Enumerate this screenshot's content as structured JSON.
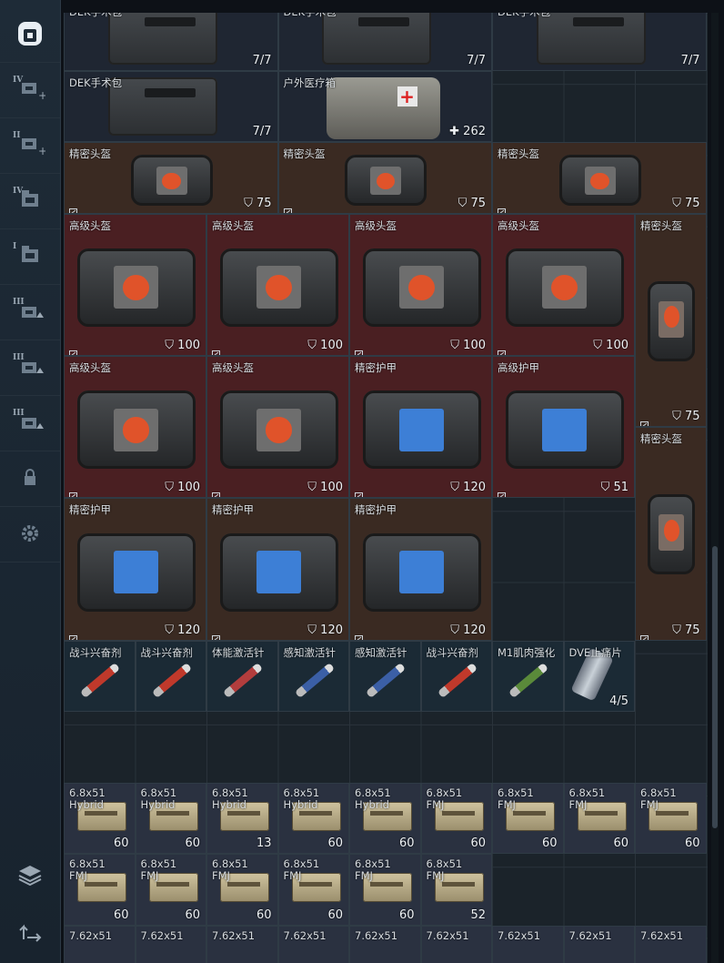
{
  "sidebar": {
    "buttons": [
      {
        "name": "backpack-icon",
        "tier": "",
        "active": true
      },
      {
        "name": "add-cell-icon",
        "tier": "IV"
      },
      {
        "name": "add-cell-icon",
        "tier": "II"
      },
      {
        "name": "folder-icon",
        "tier": "IV"
      },
      {
        "name": "folder-icon",
        "tier": "I"
      },
      {
        "name": "upgrade-icon",
        "tier": "III"
      },
      {
        "name": "upgrade-icon",
        "tier": "III"
      },
      {
        "name": "upgrade-icon",
        "tier": "III"
      },
      {
        "name": "lock-icon",
        "tier": ""
      },
      {
        "name": "gear-icon",
        "tier": ""
      }
    ],
    "bottom_buttons": [
      {
        "name": "layers-icon"
      },
      {
        "name": "transfer-icon"
      }
    ]
  },
  "items": [
    {
      "name": "DEK手术包",
      "count": "7/7",
      "kind": "kit",
      "type": "med"
    },
    {
      "name": "DEK手术包",
      "count": "7/7",
      "kind": "kit",
      "type": "med"
    },
    {
      "name": "DEK手术包",
      "count": "7/7",
      "kind": "kit",
      "type": "med"
    },
    {
      "name": "DEK手术包",
      "count": "7/7",
      "kind": "kit",
      "type": "med"
    },
    {
      "name": "户外医疗箱",
      "count": "✚ 262",
      "kind": "medkit",
      "type": "med"
    },
    {
      "name": "精密头盔",
      "count": "⛉ 75",
      "kind": "bag-s",
      "type": "helm"
    },
    {
      "name": "精密头盔",
      "count": "⛉ 75",
      "kind": "bag-s",
      "type": "helm"
    },
    {
      "name": "精密头盔",
      "count": "⛉ 75",
      "kind": "bag-s",
      "type": "helm"
    },
    {
      "name": "高级头盔",
      "count": "⛉ 100",
      "kind": "bag-l",
      "type": "helm2"
    },
    {
      "name": "高级头盔",
      "count": "⛉ 100",
      "kind": "bag-l",
      "type": "helm2"
    },
    {
      "name": "高级头盔",
      "count": "⛉ 100",
      "kind": "bag-l",
      "type": "helm2"
    },
    {
      "name": "高级头盔",
      "count": "⛉ 100",
      "kind": "bag-l",
      "type": "helm2"
    },
    {
      "name": "精密头盔",
      "count": "⛉ 75",
      "kind": "bag-v",
      "type": "helm"
    },
    {
      "name": "高级头盔",
      "count": "⛉ 100",
      "kind": "bag-l",
      "type": "helm2"
    },
    {
      "name": "高级头盔",
      "count": "⛉ 100",
      "kind": "bag-l",
      "type": "helm2"
    },
    {
      "name": "精密护甲",
      "count": "⛉ 120",
      "kind": "armor",
      "type": "helm2"
    },
    {
      "name": "高级护甲",
      "count": "⛉ 51",
      "kind": "armor-b",
      "type": "helm2"
    },
    {
      "name": "精密头盔",
      "count": "⛉ 75",
      "kind": "bag-v",
      "type": "helm"
    },
    {
      "name": "精密护甲",
      "count": "⛉ 120",
      "kind": "armor",
      "type": "helm"
    },
    {
      "name": "精密护甲",
      "count": "⛉ 120",
      "kind": "armor",
      "type": "helm"
    },
    {
      "name": "精密护甲",
      "count": "⛉ 120",
      "kind": "armor",
      "type": "helm"
    },
    {
      "name": "战斗兴奋剂",
      "count": "",
      "kind": "syr-red",
      "type": "stim"
    },
    {
      "name": "战斗兴奋剂",
      "count": "",
      "kind": "syr-red",
      "type": "stim"
    },
    {
      "name": "体能激活针",
      "count": "",
      "kind": "syr-red2",
      "type": "stim"
    },
    {
      "name": "感知激活针",
      "count": "",
      "kind": "syr-blue",
      "type": "stim"
    },
    {
      "name": "感知激活针",
      "count": "",
      "kind": "syr-blue",
      "type": "stim"
    },
    {
      "name": "战斗兴奋剂",
      "count": "",
      "kind": "syr-red",
      "type": "stim"
    },
    {
      "name": "M1肌肉强化",
      "count": "",
      "kind": "syr-green",
      "type": "stim"
    },
    {
      "name": "DVE止痛片",
      "count": "4/5",
      "kind": "can",
      "type": "stim"
    },
    {
      "name": "6.8x51\nHybrid",
      "count": "60",
      "kind": "ammo",
      "type": "ammo"
    },
    {
      "name": "6.8x51\nHybrid",
      "count": "60",
      "kind": "ammo",
      "type": "ammo"
    },
    {
      "name": "6.8x51\nHybrid",
      "count": "13",
      "kind": "ammo",
      "type": "ammo"
    },
    {
      "name": "6.8x51\nHybrid",
      "count": "60",
      "kind": "ammo",
      "type": "ammo"
    },
    {
      "name": "6.8x51\nHybrid",
      "count": "60",
      "kind": "ammo",
      "type": "ammo"
    },
    {
      "name": "6.8x51\nFMJ",
      "count": "60",
      "kind": "ammo",
      "type": "ammo"
    },
    {
      "name": "6.8x51\nFMJ",
      "count": "60",
      "kind": "ammo",
      "type": "ammo"
    },
    {
      "name": "6.8x51\nFMJ",
      "count": "60",
      "kind": "ammo",
      "type": "ammo"
    },
    {
      "name": "6.8x51\nFMJ",
      "count": "60",
      "kind": "ammo",
      "type": "ammo"
    },
    {
      "name": "6.8x51\nFMJ",
      "count": "60",
      "kind": "ammo",
      "type": "ammo"
    },
    {
      "name": "6.8x51\nFMJ",
      "count": "60",
      "kind": "ammo",
      "type": "ammo"
    },
    {
      "name": "6.8x51\nFMJ",
      "count": "60",
      "kind": "ammo",
      "type": "ammo"
    },
    {
      "name": "6.8x51\nFMJ",
      "count": "60",
      "kind": "ammo",
      "type": "ammo"
    },
    {
      "name": "6.8x51\nFMJ",
      "count": "60",
      "kind": "ammo",
      "type": "ammo"
    },
    {
      "name": "6.8x51\nFMJ",
      "count": "52",
      "kind": "ammo",
      "type": "ammo"
    },
    {
      "name": "7.62x51",
      "count": "",
      "kind": "none",
      "type": "ammo"
    },
    {
      "name": "7.62x51",
      "count": "",
      "kind": "none",
      "type": "ammo"
    },
    {
      "name": "7.62x51",
      "count": "",
      "kind": "none",
      "type": "ammo"
    },
    {
      "name": "7.62x51",
      "count": "",
      "kind": "none",
      "type": "ammo"
    },
    {
      "name": "7.62x51",
      "count": "",
      "kind": "none",
      "type": "ammo"
    },
    {
      "name": "7.62x51",
      "count": "",
      "kind": "none",
      "type": "ammo"
    },
    {
      "name": "7.62x51",
      "count": "",
      "kind": "none",
      "type": "ammo"
    },
    {
      "name": "7.62x51",
      "count": "",
      "kind": "none",
      "type": "ammo"
    },
    {
      "name": "7.62x51",
      "count": "",
      "kind": "none",
      "type": "ammo"
    }
  ]
}
